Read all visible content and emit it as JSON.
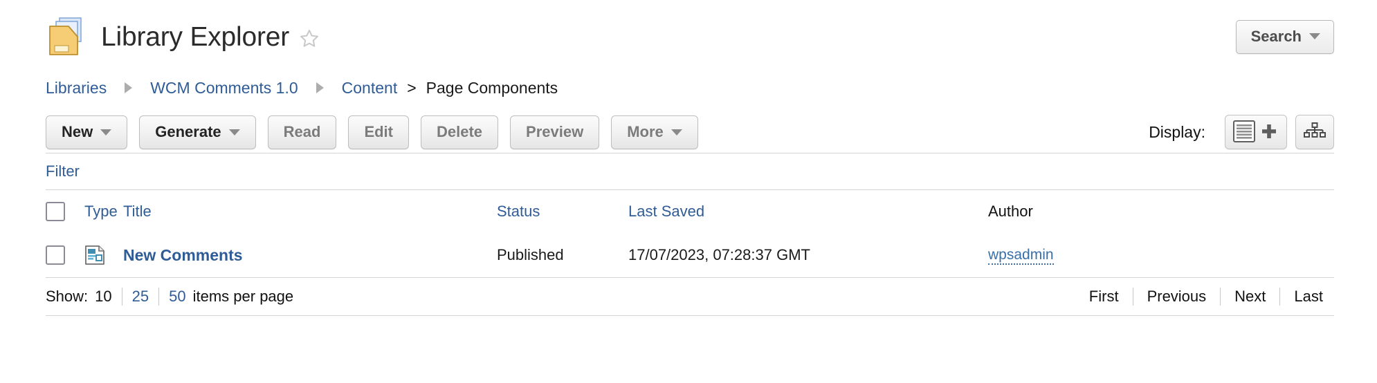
{
  "header": {
    "title": "Library Explorer",
    "library_icon": "library-folder-icon",
    "favorite_icon": "star-outline-icon",
    "search_label": "Search"
  },
  "breadcrumb": {
    "items": [
      {
        "label": "Libraries",
        "type": "link"
      },
      {
        "label": "WCM Comments 1.0",
        "type": "link"
      },
      {
        "label": "Content",
        "type": "link"
      },
      {
        "label": "Page Components",
        "type": "current"
      }
    ],
    "separator_arrow": "triangle-right-icon",
    "separator_gt": ">"
  },
  "toolbar": {
    "buttons": [
      {
        "label": "New",
        "enabled": true,
        "dropdown": true
      },
      {
        "label": "Generate",
        "enabled": true,
        "dropdown": true
      },
      {
        "label": "Read",
        "enabled": false,
        "dropdown": false
      },
      {
        "label": "Edit",
        "enabled": false,
        "dropdown": false
      },
      {
        "label": "Delete",
        "enabled": false,
        "dropdown": false
      },
      {
        "label": "Preview",
        "enabled": false,
        "dropdown": false
      },
      {
        "label": "More",
        "enabled": false,
        "dropdown": true
      }
    ],
    "display_label": "Display:",
    "view_buttons": [
      {
        "name": "list-view-button",
        "icon": "list-lines-plus-icon",
        "selected": true
      },
      {
        "name": "tree-view-button",
        "icon": "site-tree-icon",
        "selected": false
      }
    ]
  },
  "filter": {
    "label": "Filter"
  },
  "table": {
    "columns": [
      {
        "label": "Type",
        "sortable": true
      },
      {
        "label": "Title",
        "sortable": true
      },
      {
        "label": "Status",
        "sortable": true
      },
      {
        "label": "Last Saved",
        "sortable": true
      },
      {
        "label": "Author",
        "sortable": false
      }
    ],
    "select_all_checkbox": "unchecked",
    "rows": [
      {
        "checkbox": "unchecked",
        "type_icon": "page-component-icon",
        "title": "New Comments",
        "status": "Published",
        "last_saved": "17/07/2023, 07:28:37 GMT",
        "author": "wpsadmin"
      }
    ]
  },
  "footer": {
    "show_label": "Show:",
    "page_sizes": [
      {
        "label": "10",
        "selected": true
      },
      {
        "label": "25",
        "selected": false
      },
      {
        "label": "50",
        "selected": false
      }
    ],
    "items_per_page_label": "items per page",
    "pagination": [
      {
        "label": "First"
      },
      {
        "label": "Previous"
      },
      {
        "label": "Next"
      },
      {
        "label": "Last"
      }
    ]
  },
  "colors": {
    "link_blue": "#2f5c97",
    "text_dark": "#1a1a1a",
    "disabled_gray": "#7b7b7b",
    "rule_gray": "#d4d4d4",
    "folder_yellow": "#f5c463"
  }
}
